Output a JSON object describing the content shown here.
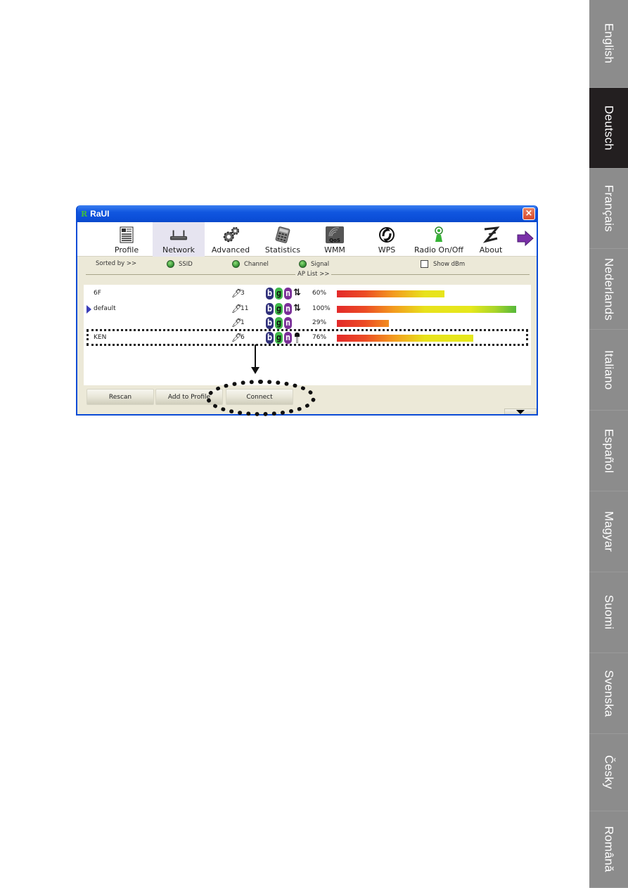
{
  "language_tabs": [
    {
      "label": "English",
      "active": false
    },
    {
      "label": "Deutsch",
      "active": true
    },
    {
      "label": "Français",
      "active": false
    },
    {
      "label": "Nederlands",
      "active": false
    },
    {
      "label": "Italiano",
      "active": false
    },
    {
      "label": "Español",
      "active": false
    },
    {
      "label": "Magyar",
      "active": false
    },
    {
      "label": "Suomi",
      "active": false
    },
    {
      "label": "Svenska",
      "active": false
    },
    {
      "label": "Česky",
      "active": false
    },
    {
      "label": "Română",
      "active": false
    }
  ],
  "window": {
    "logo": "R",
    "title": "RaUI",
    "close_icon": "×"
  },
  "toolbar": [
    {
      "label": "Profile",
      "icon": "profile-document-icon",
      "active": false
    },
    {
      "label": "Network",
      "icon": "router-icon",
      "active": true
    },
    {
      "label": "Advanced",
      "icon": "gears-icon",
      "active": false
    },
    {
      "label": "Statistics",
      "icon": "calculator-icon",
      "active": false
    },
    {
      "label": "WMM",
      "icon": "qos-icon",
      "active": false
    },
    {
      "label": "WPS",
      "icon": "wps-icon",
      "active": false
    },
    {
      "label": "Radio On/Off",
      "icon": "radio-antenna-icon",
      "active": false
    },
    {
      "label": "About",
      "icon": "about-logo-icon",
      "active": false
    }
  ],
  "next_arrow_icon": "purple-right-arrow-icon",
  "sort": {
    "label": "Sorted by >>",
    "options": [
      "SSID",
      "Channel",
      "Signal"
    ],
    "show_dbm_label": "Show dBm",
    "show_dbm_checked": false
  },
  "ap_list": {
    "header": "AP List >>",
    "rows": [
      {
        "ssid": "6F",
        "selected": false,
        "channel": "3",
        "modes": [
          "b",
          "g",
          "n"
        ],
        "wps": true,
        "secured": false,
        "signal_text": "60%",
        "signal": 0.6
      },
      {
        "ssid": "default",
        "selected": true,
        "channel": "11",
        "modes": [
          "b",
          "g",
          "n"
        ],
        "wps": true,
        "secured": false,
        "signal_text": "100%",
        "signal": 1.0
      },
      {
        "ssid": "",
        "selected": false,
        "channel": "1",
        "modes": [
          "b",
          "g",
          "n"
        ],
        "wps": false,
        "secured": false,
        "signal_text": "29%",
        "signal": 0.29
      },
      {
        "ssid": "KEN",
        "selected": false,
        "channel": "6",
        "modes": [
          "b",
          "g",
          "n"
        ],
        "wps": false,
        "secured": true,
        "signal_text": "76%",
        "signal": 0.76
      }
    ]
  },
  "buttons": {
    "rescan": "Rescan",
    "add_to_profile": "Add to Profile",
    "connect": "Connect"
  }
}
